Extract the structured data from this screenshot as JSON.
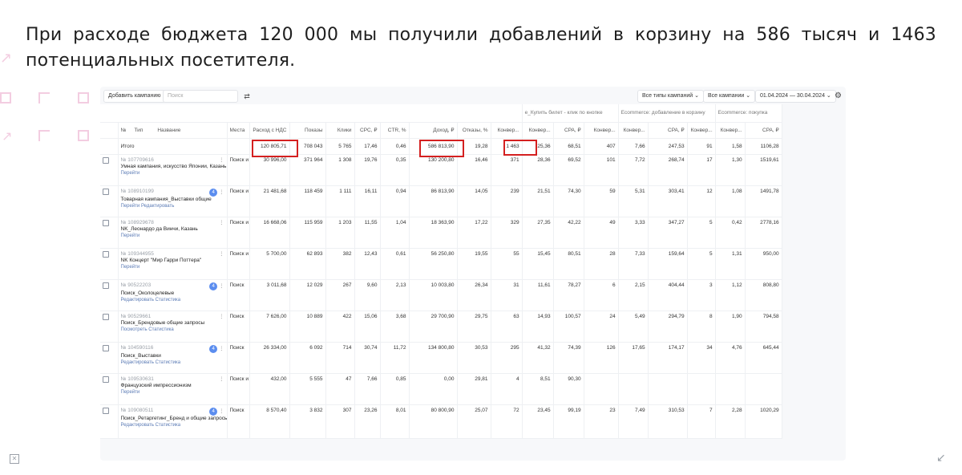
{
  "headline": "При расходе бюджета 120 000 мы получили добавлений в корзину на 586 тысяч и 1463 потенциальных посетителя.",
  "toolbar": {
    "add_campaign": "Добавить кампанию",
    "search_placeholder": "Поиск",
    "filter_icon": "sliders-icon",
    "campaign_types": "Все типы кампаний",
    "campaigns": "Все кампании",
    "date_range": "01.04.2024 — 30.04.2024",
    "gear_icon": "gear-icon"
  },
  "groups": {
    "goal1": "e_Купить билет - клик по кнопке",
    "goal2": "Ecommerce: добавление в корзину",
    "goal3": "Ecommerce: покупка"
  },
  "headers": [
    "№",
    "Тип",
    "Название",
    "Места",
    "Расход с НДС",
    "Показы",
    "Клики",
    "CPC, ₽",
    "CTR, %",
    "Доход, ₽",
    "Отказы, %",
    "Конвер...",
    "Конвер...",
    "CPA, ₽",
    "Конвер...",
    "Конвер...",
    "CPA, ₽",
    "Конвер...",
    "Конвер...",
    "CPA, ₽"
  ],
  "total": {
    "label": "Итого",
    "values": [
      "120 805,71",
      "708 043",
      "5 765",
      "17,46",
      "0,46",
      "586 813,90",
      "19,28",
      "1 463",
      "25,36",
      "68,51",
      "407",
      "7,66",
      "247,53",
      "91",
      "1,58",
      "1106,28"
    ]
  },
  "rows": [
    {
      "id": "№ 107709616",
      "name": "Умная кампания, искусство Японии, Казань (исх.Артплей)",
      "links": "Перейти",
      "place": "Поиск и РСЯ",
      "badge": "",
      "values": [
        "30 996,00",
        "371 964",
        "1 308",
        "19,76",
        "0,35",
        "130 200,80",
        "16,46",
        "371",
        "28,36",
        "69,52",
        "101",
        "7,72",
        "268,74",
        "17",
        "1,30",
        "1519,61"
      ]
    },
    {
      "id": "№ 108910199",
      "name": "Товарная кампания_Выставки общие",
      "links": "Перейти   Редактировать",
      "place": "Поиск и РСЯ",
      "badge": "4",
      "values": [
        "21 481,68",
        "118 459",
        "1 111",
        "16,11",
        "0,94",
        "86 813,90",
        "14,05",
        "239",
        "21,51",
        "74,30",
        "59",
        "5,31",
        "303,41",
        "12",
        "1,08",
        "1491,78"
      ]
    },
    {
      "id": "№ 108929678",
      "name": "NK_Леонардо да Винчи, Казань",
      "links": "Перейти",
      "place": "Поиск и РСЯ",
      "badge": "",
      "values": [
        "16 668,06",
        "115 959",
        "1 203",
        "11,55",
        "1,04",
        "18 363,90",
        "17,22",
        "329",
        "27,35",
        "42,22",
        "49",
        "3,33",
        "347,27",
        "5",
        "0,42",
        "2778,16"
      ]
    },
    {
      "id": "№ 109344955",
      "name": "NK Концерт \"Мир Гарри Поттера\"",
      "links": "Перейти",
      "place": "Поиск и РСЯ",
      "badge": "",
      "values": [
        "5 700,00",
        "62 893",
        "382",
        "12,43",
        "0,61",
        "56 250,80",
        "19,55",
        "55",
        "15,45",
        "80,51",
        "28",
        "7,33",
        "159,64",
        "5",
        "1,31",
        "950,00"
      ]
    },
    {
      "id": "№ 90522203",
      "name": "Поиск_Околоцелевые",
      "links": "Редактировать   Статистика",
      "place": "Поиск",
      "badge": "4",
      "values": [
        "3 011,68",
        "12 029",
        "267",
        "9,60",
        "2,13",
        "10 003,80",
        "26,34",
        "31",
        "11,61",
        "78,27",
        "6",
        "2,15",
        "404,44",
        "3",
        "1,12",
        "808,80"
      ]
    },
    {
      "id": "№ 90529661",
      "name": "Поиск_Брендовые общие запросы",
      "links": "Посмотреть   Статистика",
      "place": "Поиск",
      "badge": "",
      "values": [
        "7 626,00",
        "10 889",
        "422",
        "15,06",
        "3,68",
        "29 700,90",
        "29,75",
        "63",
        "14,93",
        "100,57",
        "24",
        "5,49",
        "294,79",
        "8",
        "1,90",
        "794,58"
      ]
    },
    {
      "id": "№ 104590116",
      "name": "Поиск_Выставки",
      "links": "Редактировать   Статистика",
      "place": "Поиск",
      "badge": "4",
      "values": [
        "26 334,00",
        "6 092",
        "714",
        "30,74",
        "11,72",
        "134 800,80",
        "30,53",
        "295",
        "41,32",
        "74,39",
        "126",
        "17,65",
        "174,17",
        "34",
        "4,76",
        "645,44"
      ]
    },
    {
      "id": "№ 109530631",
      "name": "Французский импрессионизм",
      "links": "Перейти",
      "place": "Поиск и РСЯ",
      "badge": "",
      "values": [
        "432,00",
        "5 555",
        "47",
        "7,66",
        "0,85",
        "0,00",
        "29,81",
        "4",
        "8,51",
        "90,30",
        "",
        "",
        "",
        "",
        "",
        ""
      ]
    },
    {
      "id": "№ 109080511",
      "name": "Поиск_Ретаргетинг_Бренд и общие запросы",
      "links": "Редактировать   Статистика",
      "place": "Поиск",
      "badge": "4",
      "values": [
        "8 570,40",
        "3 832",
        "307",
        "23,26",
        "8,01",
        "80 800,90",
        "25,07",
        "72",
        "23,45",
        "99,19",
        "23",
        "7,49",
        "310,53",
        "7",
        "2,28",
        "1020,29"
      ]
    }
  ]
}
